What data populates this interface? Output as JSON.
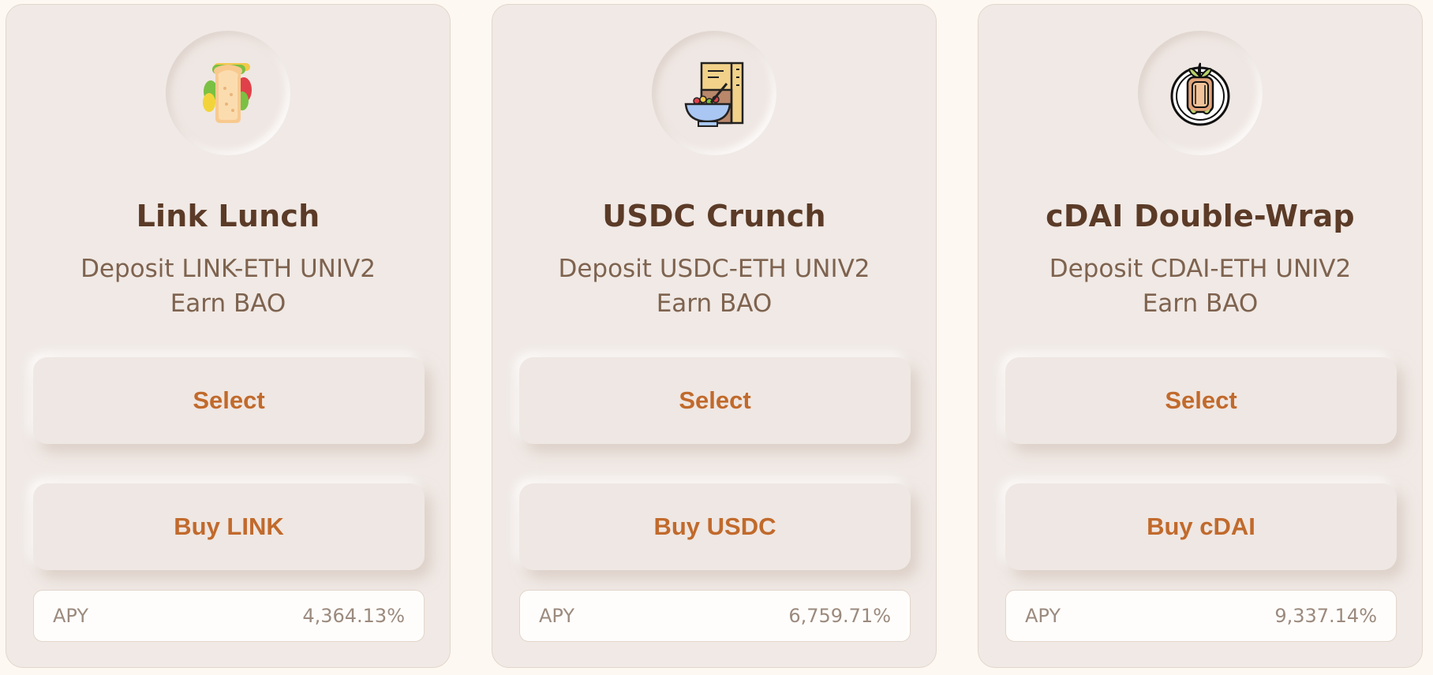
{
  "cards": [
    {
      "icon": "sandwich-icon",
      "title": "Link Lunch",
      "desc_line1": "Deposit LINK-ETH UNIV2",
      "desc_line2": "Earn BAO",
      "select_label": "Select",
      "buy_label": "Buy LINK",
      "apy_label": "APY",
      "apy_value": "4,364.13%"
    },
    {
      "icon": "cereal-bowl-icon",
      "title": "USDC Crunch",
      "desc_line1": "Deposit USDC-ETH UNIV2",
      "desc_line2": "Earn BAO",
      "select_label": "Select",
      "buy_label": "Buy USDC",
      "apy_label": "APY",
      "apy_value": "6,759.71%"
    },
    {
      "icon": "burrito-plate-icon",
      "title": "cDAI Double-Wrap",
      "desc_line1": "Deposit CDAI-ETH UNIV2",
      "desc_line2": "Earn BAO",
      "select_label": "Select",
      "buy_label": "Buy cDAI",
      "apy_label": "APY",
      "apy_value": "9,337.14%"
    }
  ],
  "colors": {
    "page_background": "#fdf8f1",
    "card_background": "#f0e9e5",
    "title_text": "#5b3b27",
    "description_text": "#7e634f",
    "button_text": "#c16a2c",
    "apy_text": "#9b8a7e"
  }
}
